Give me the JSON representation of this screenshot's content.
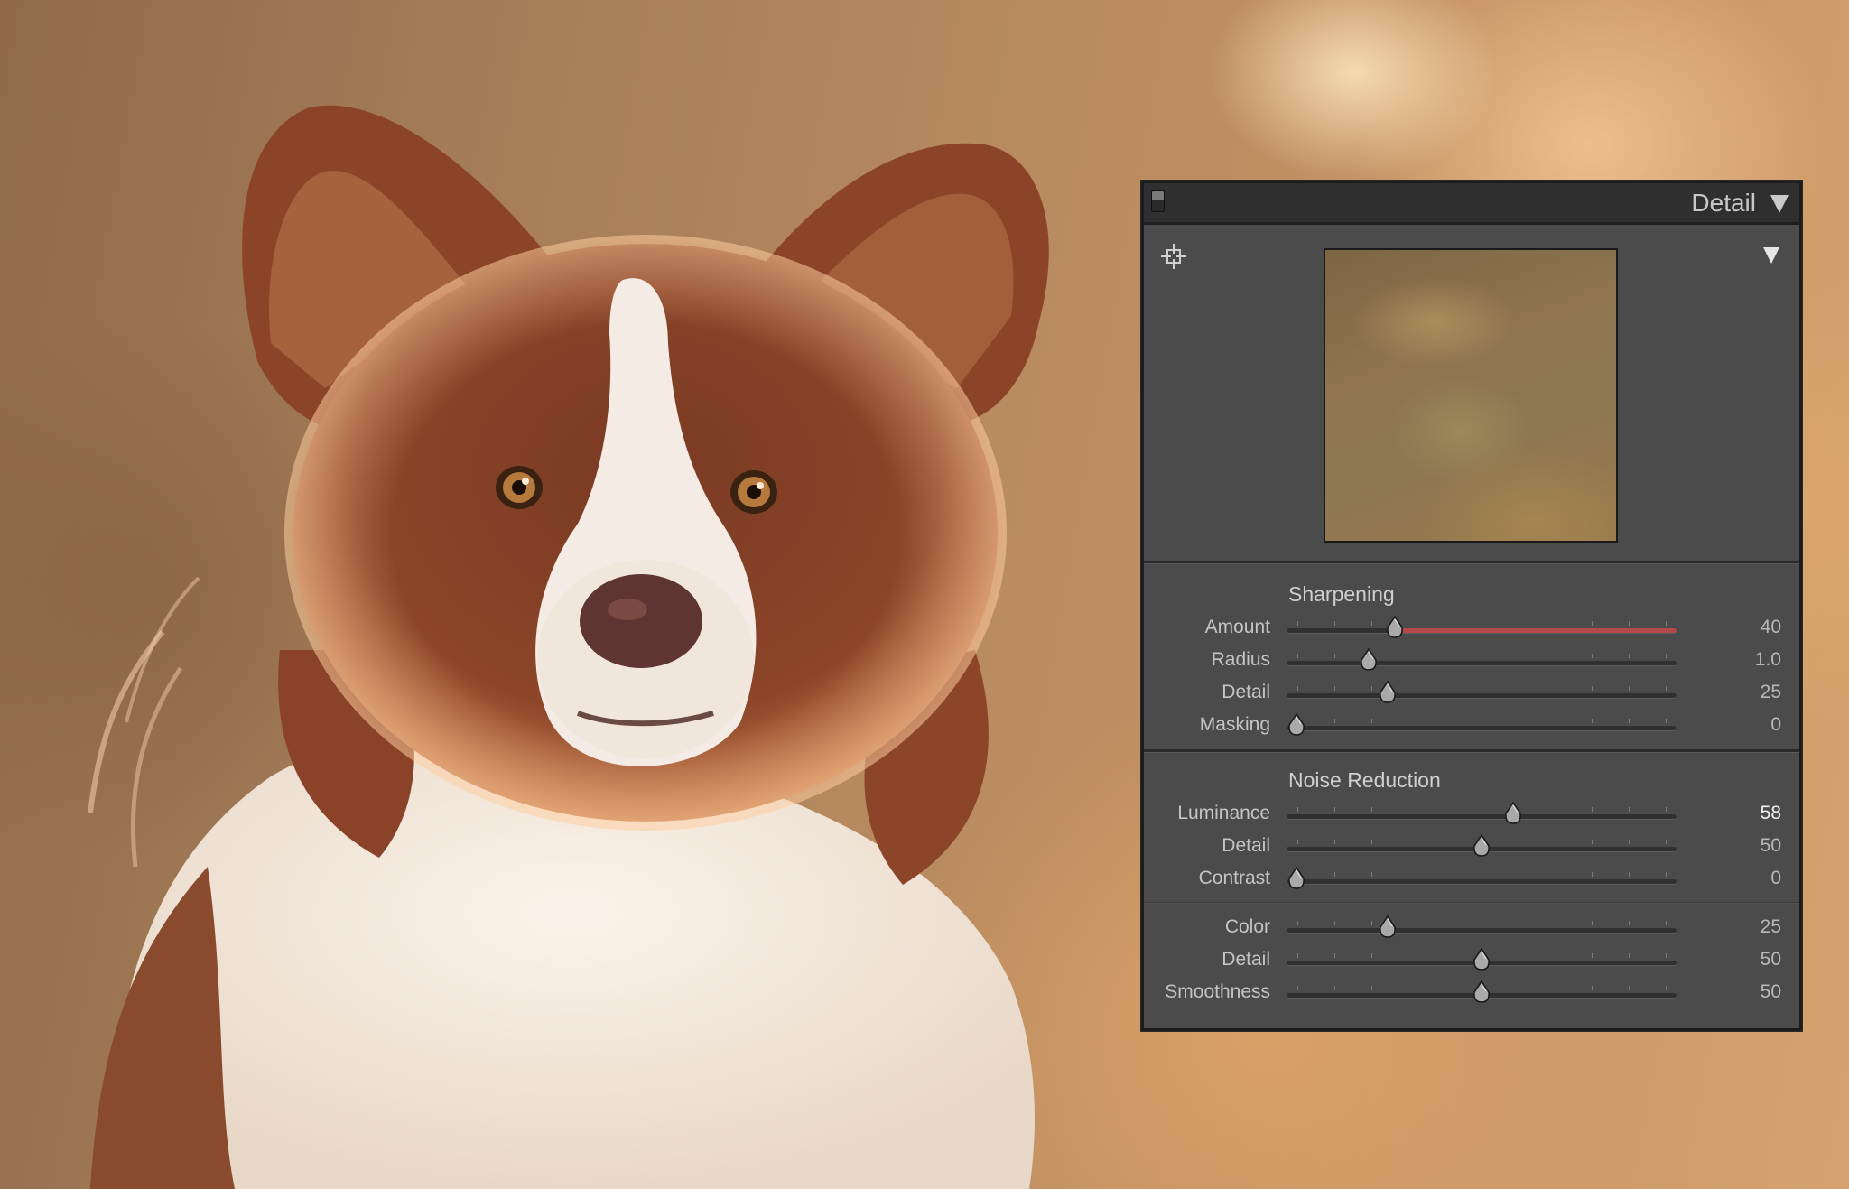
{
  "panel": {
    "title": "Detail",
    "sharpening": {
      "title": "Sharpening",
      "sliders": [
        {
          "label": "Amount",
          "value": "40",
          "fraction": 0.2775
        },
        {
          "label": "Radius",
          "value": "1.0",
          "fraction": 0.21
        },
        {
          "label": "Detail",
          "value": "25",
          "fraction": 0.26
        },
        {
          "label": "Masking",
          "value": "0",
          "fraction": 0.025
        }
      ]
    },
    "noise_reduction": {
      "title": "Noise Reduction",
      "luminance_sliders": [
        {
          "label": "Luminance",
          "value": "58",
          "fraction": 0.58
        },
        {
          "label": "Detail",
          "value": "50",
          "fraction": 0.5
        },
        {
          "label": "Contrast",
          "value": "0",
          "fraction": 0.025
        }
      ],
      "color_sliders": [
        {
          "label": "Color",
          "value": "25",
          "fraction": 0.26
        },
        {
          "label": "Detail",
          "value": "50",
          "fraction": 0.5
        },
        {
          "label": "Smoothness",
          "value": "50",
          "fraction": 0.5
        }
      ]
    }
  },
  "colors": {
    "panel_bg": "#4b4b4b",
    "header_bg": "#2f2f2f",
    "sharpening_amount_track": "#b24a4a"
  },
  "icons": [
    "panel-toggle-icon",
    "collapse-triangle-icon",
    "target-adjustment-icon",
    "preview-toggle-triangle-icon",
    "slider-thumb-icon"
  ]
}
